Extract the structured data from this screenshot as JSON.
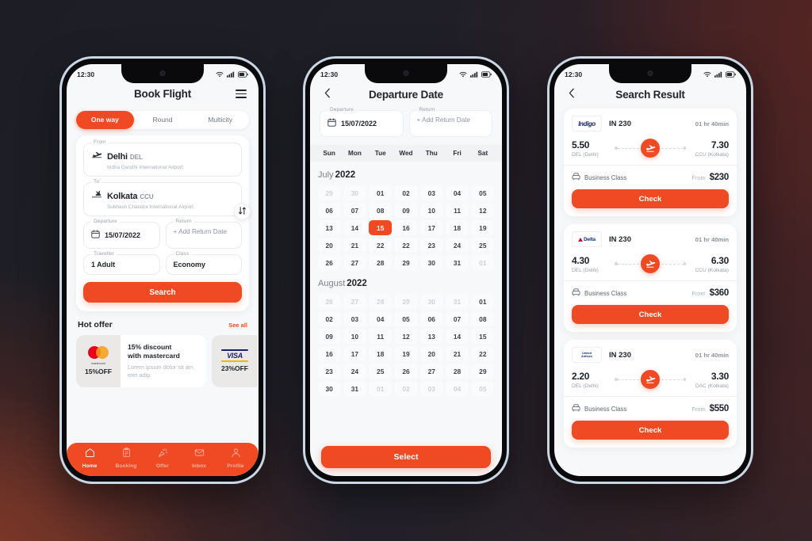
{
  "theme": {
    "accent": "#ef4a23",
    "screen_bg": "#f7f8f9",
    "card_bg": "#ffffff",
    "text_dark": "#1e212a",
    "text_muted": "#9aa0ab",
    "frame": "#c9d6e4",
    "bezel": "#0a0a0c"
  },
  "status_bar": {
    "time": "12:30",
    "icons": [
      "wifi-icon",
      "signal-icon",
      "battery-icon"
    ]
  },
  "phone1": {
    "header": {
      "title": "Book Flight",
      "menu_icon": "hamburger-icon"
    },
    "segments": [
      {
        "label": "One way",
        "active": true
      },
      {
        "label": "Round",
        "active": false
      },
      {
        "label": "Multicity",
        "active": false
      }
    ],
    "from": {
      "label": "From",
      "city": "Delhi",
      "code": "DEL",
      "airport": "Indira Gandhi International Airport"
    },
    "to": {
      "label": "To",
      "city": "Kolkata",
      "code": "CCU",
      "airport": "Subhash Chandra International Airport"
    },
    "swap_icon": "swap-vertical-icon",
    "departure": {
      "label": "Departure",
      "value": "15/07/2022"
    },
    "return": {
      "label": "Return",
      "value": "+ Add Return Date"
    },
    "traveller": {
      "label": "Traveller",
      "value": "1 Adult"
    },
    "class": {
      "label": "Class",
      "value": "Economy"
    },
    "search_button": "Search",
    "hot_offer": {
      "title": "Hot offer",
      "see_all": "See all",
      "cards": [
        {
          "brand": "mastercard",
          "brand_word": "mastercard",
          "pct": "15%OFF",
          "heading": "15% discount\nwith mastercard",
          "body": "Lorem ipsum dolor sit am etet adip"
        },
        {
          "brand": "visa",
          "brand_word": "VISA",
          "pct": "23%OFF",
          "heading": "",
          "body": ""
        }
      ]
    },
    "tabs": [
      {
        "label": "Home",
        "icon": "home-icon",
        "active": true
      },
      {
        "label": "Booking",
        "icon": "clipboard-icon",
        "active": false
      },
      {
        "label": "Offer",
        "icon": "confetti-icon",
        "active": false
      },
      {
        "label": "Inbox",
        "icon": "envelope-icon",
        "active": false
      },
      {
        "label": "Profile",
        "icon": "person-icon",
        "active": false
      }
    ]
  },
  "phone2": {
    "header": {
      "title": "Departure Date",
      "back_icon": "chevron-left-icon"
    },
    "departure": {
      "label": "Departure",
      "value": "15/07/2022"
    },
    "return": {
      "label": "Return",
      "value": "+ Add Return Date"
    },
    "dow": [
      "Sun",
      "Mon",
      "Tue",
      "Wed",
      "Thu",
      "Fri",
      "Sat"
    ],
    "months": [
      {
        "name": "July",
        "year": "2022",
        "days": [
          {
            "d": "29",
            "out": true
          },
          {
            "d": "30",
            "out": true
          },
          {
            "d": "01"
          },
          {
            "d": "02"
          },
          {
            "d": "03"
          },
          {
            "d": "04"
          },
          {
            "d": "05"
          },
          {
            "d": "06"
          },
          {
            "d": "07"
          },
          {
            "d": "08"
          },
          {
            "d": "09"
          },
          {
            "d": "10"
          },
          {
            "d": "11"
          },
          {
            "d": "12"
          },
          {
            "d": "13"
          },
          {
            "d": "14"
          },
          {
            "d": "15",
            "sel": true
          },
          {
            "d": "16"
          },
          {
            "d": "17"
          },
          {
            "d": "18"
          },
          {
            "d": "19"
          },
          {
            "d": "20"
          },
          {
            "d": "21"
          },
          {
            "d": "22"
          },
          {
            "d": "22"
          },
          {
            "d": "23"
          },
          {
            "d": "24"
          },
          {
            "d": "25"
          },
          {
            "d": "26"
          },
          {
            "d": "27"
          },
          {
            "d": "28"
          },
          {
            "d": "29"
          },
          {
            "d": "30"
          },
          {
            "d": "31"
          },
          {
            "d": "01",
            "out": true
          }
        ]
      },
      {
        "name": "August",
        "year": "2022",
        "days": [
          {
            "d": "26",
            "out": true
          },
          {
            "d": "27",
            "out": true
          },
          {
            "d": "28",
            "out": true
          },
          {
            "d": "29",
            "out": true
          },
          {
            "d": "30",
            "out": true
          },
          {
            "d": "31",
            "out": true
          },
          {
            "d": "01"
          },
          {
            "d": "02"
          },
          {
            "d": "03"
          },
          {
            "d": "04"
          },
          {
            "d": "05"
          },
          {
            "d": "06"
          },
          {
            "d": "07"
          },
          {
            "d": "08"
          },
          {
            "d": "09"
          },
          {
            "d": "10"
          },
          {
            "d": "11"
          },
          {
            "d": "12"
          },
          {
            "d": "13"
          },
          {
            "d": "14"
          },
          {
            "d": "15"
          },
          {
            "d": "16"
          },
          {
            "d": "17"
          },
          {
            "d": "18"
          },
          {
            "d": "19"
          },
          {
            "d": "20"
          },
          {
            "d": "21"
          },
          {
            "d": "22"
          },
          {
            "d": "23"
          },
          {
            "d": "24"
          },
          {
            "d": "25"
          },
          {
            "d": "26"
          },
          {
            "d": "27"
          },
          {
            "d": "28"
          },
          {
            "d": "29"
          },
          {
            "d": "30"
          },
          {
            "d": "31"
          },
          {
            "d": "01",
            "out": true
          },
          {
            "d": "02",
            "out": true
          },
          {
            "d": "03",
            "out": true
          },
          {
            "d": "04",
            "out": true
          },
          {
            "d": "05",
            "out": true
          }
        ]
      }
    ],
    "select_button": "Select"
  },
  "phone3": {
    "header": {
      "title": "Search Result",
      "back_icon": "chevron-left-icon"
    },
    "from_label": "From",
    "class_icon": "seat-icon",
    "check_button": "Check",
    "results": [
      {
        "airline": "Indigo",
        "airline_logo": "indigo-logo",
        "flight_no": "IN 230",
        "duration": "01 hr 40min",
        "dep_time": "5.50",
        "dep_code": "DEL (Delhi)",
        "arr_time": "7.30",
        "arr_code": "CCU (Kolkata)",
        "cabin": "Business Class",
        "price": "$230"
      },
      {
        "airline": "Delta",
        "airline_logo": "delta-logo",
        "flight_no": "IN 230",
        "duration": "01 hr 40min",
        "dep_time": "4.30",
        "dep_code": "DEL (Delhi)",
        "arr_time": "6.30",
        "arr_code": "CCU (Kolkata)",
        "cabin": "Business Class",
        "price": "$360"
      },
      {
        "airline": "United Airlines",
        "airline_logo": "united-logo",
        "flight_no": "IN 230",
        "duration": "01 hr 40min",
        "dep_time": "2.20",
        "dep_code": "DEL (Delhi)",
        "arr_time": "3.30",
        "arr_code": "DAC (Kolkata)",
        "cabin": "Business Class",
        "price": "$550"
      }
    ]
  }
}
